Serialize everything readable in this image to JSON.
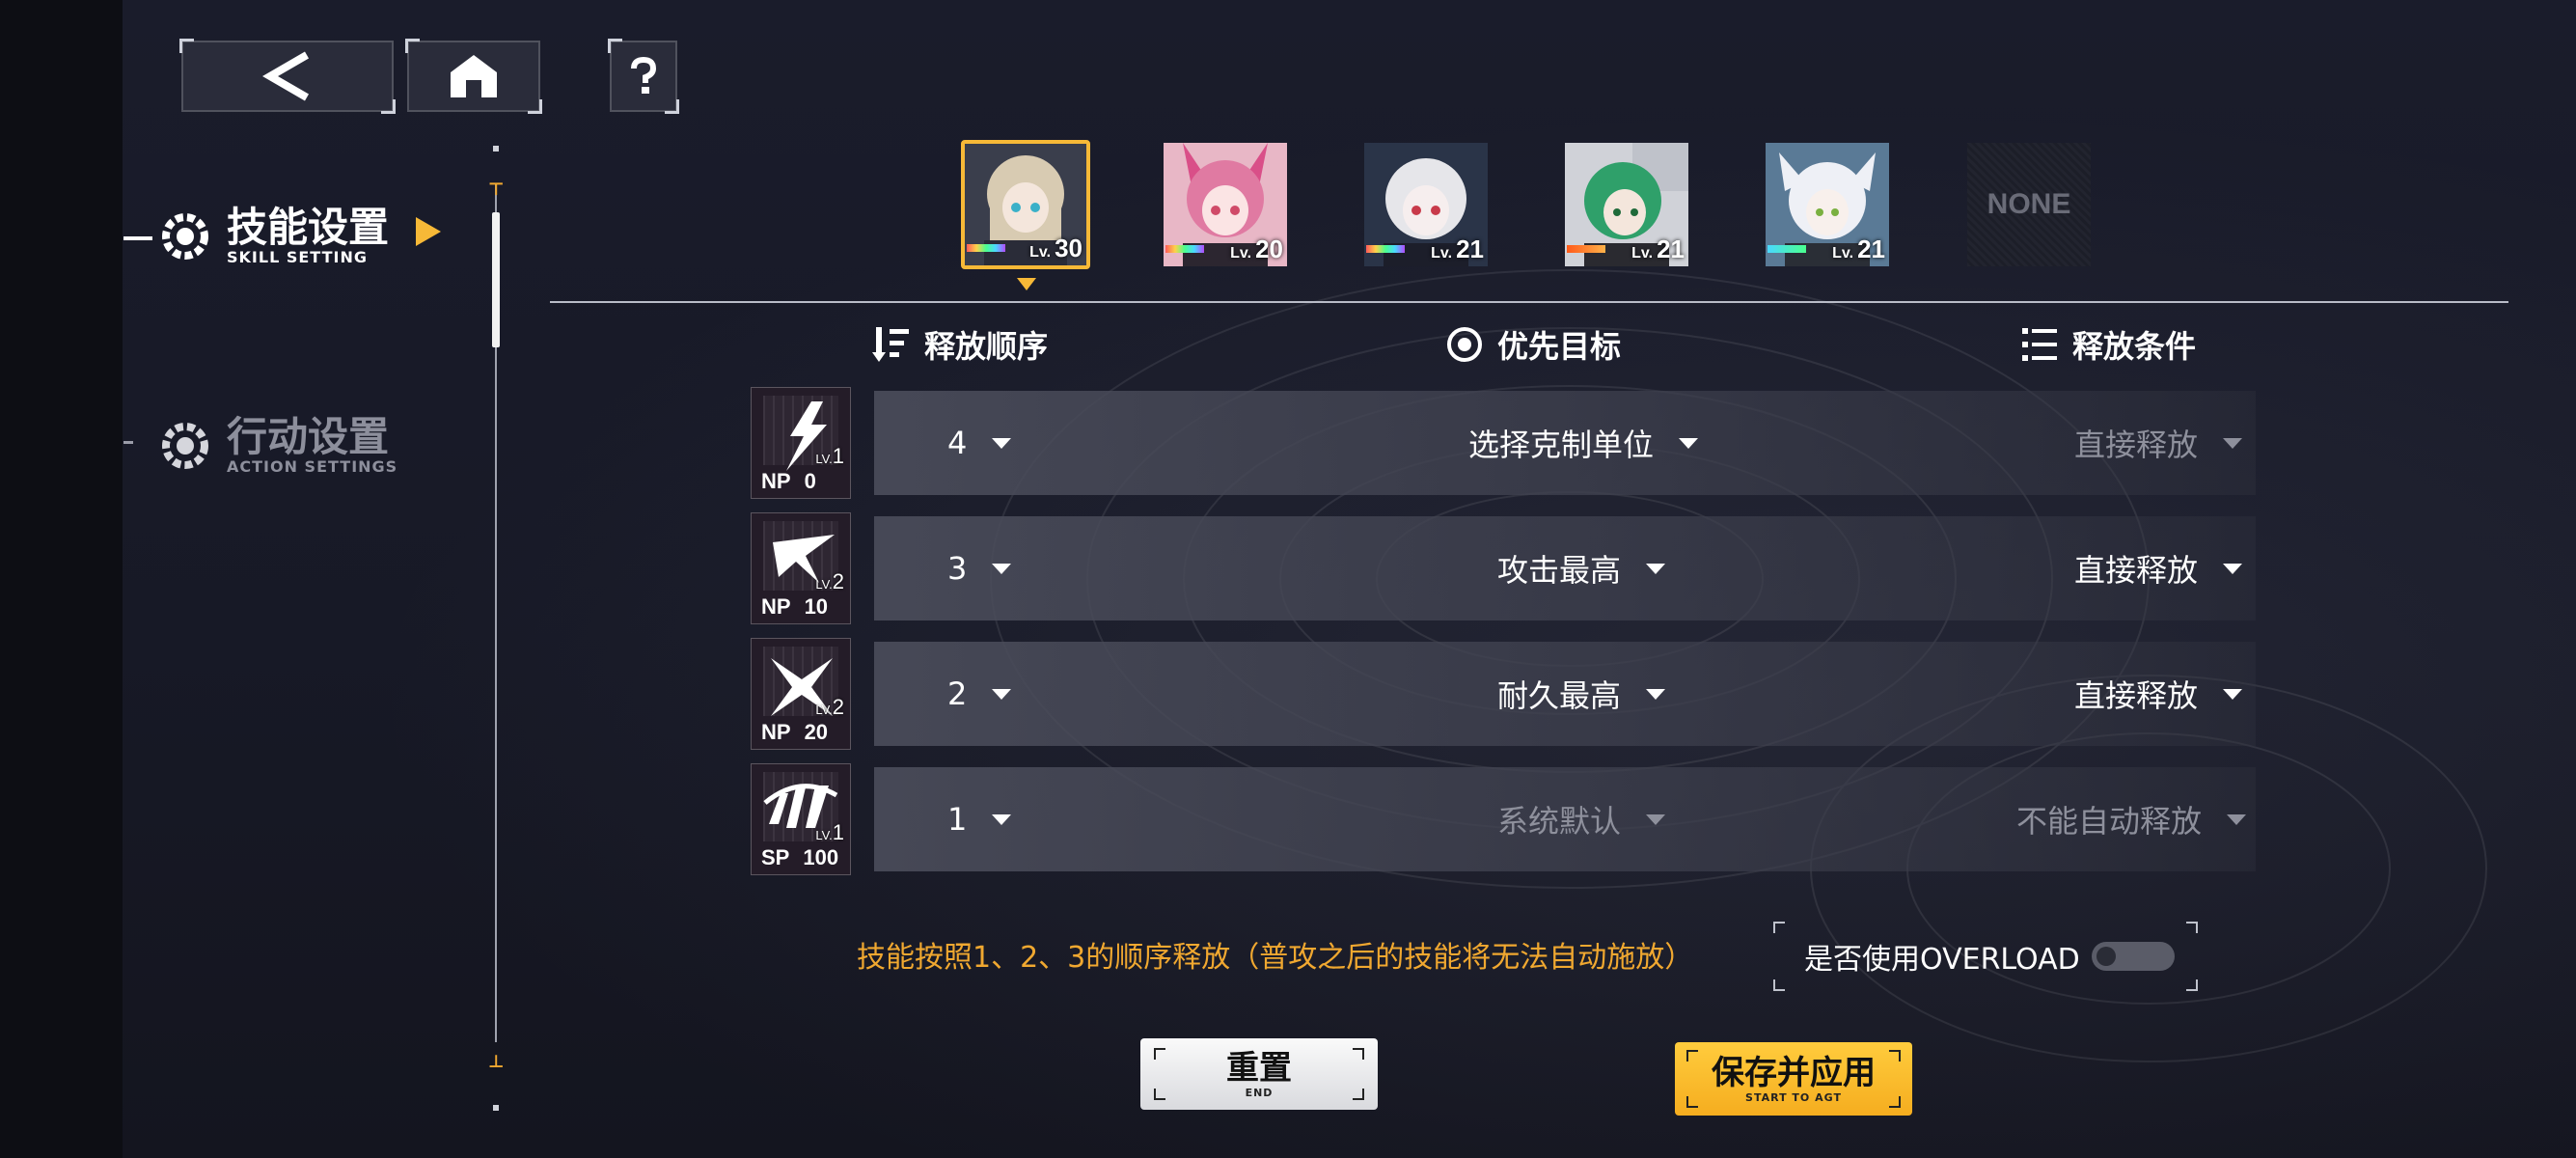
{
  "nav": {
    "back_icon": "back-arrow-icon",
    "home_icon": "home-icon",
    "help_icon": "question-icon"
  },
  "menu": [
    {
      "title": "技能设置",
      "subtitle": "SKILL SETTING",
      "active": true
    },
    {
      "title": "行动设置",
      "subtitle": "ACTION SETTINGS",
      "active": false
    }
  ],
  "characters": [
    {
      "level_prefix": "Lv.",
      "level": "30",
      "selected": true,
      "hair": "#d8cbb2",
      "accent": "#8ea6c8"
    },
    {
      "level_prefix": "Lv.",
      "level": "20",
      "selected": false,
      "hair": "#e07aa2",
      "accent": "#f0b4c8"
    },
    {
      "level_prefix": "Lv.",
      "level": "21",
      "selected": false,
      "hair": "#e6e6ea",
      "accent": "#2a3448"
    },
    {
      "level_prefix": "Lv.",
      "level": "21",
      "selected": false,
      "hair": "#2fa06a",
      "accent": "#d0d2d8"
    },
    {
      "level_prefix": "Lv.",
      "level": "21",
      "selected": false,
      "hair": "#eef0f6",
      "accent": "#8ed0e0"
    }
  ],
  "empty_slot_label": "NONE",
  "columns": {
    "order": "释放顺序",
    "target": "优先目标",
    "condition": "释放条件"
  },
  "skills": [
    {
      "lv_prefix": "LV.",
      "lv": "1",
      "cost_type": "NP",
      "cost": "0",
      "order": "4",
      "target": "选择克制单位",
      "target_enabled": true,
      "condition": "直接释放",
      "condition_enabled": false
    },
    {
      "lv_prefix": "LV.",
      "lv": "2",
      "cost_type": "NP",
      "cost": "10",
      "order": "3",
      "target": "攻击最高",
      "target_enabled": true,
      "condition": "直接释放",
      "condition_enabled": true
    },
    {
      "lv_prefix": "LV.",
      "lv": "2",
      "cost_type": "NP",
      "cost": "20",
      "order": "2",
      "target": "耐久最高",
      "target_enabled": true,
      "condition": "直接释放",
      "condition_enabled": true
    },
    {
      "lv_prefix": "LV.",
      "lv": "1",
      "cost_type": "SP",
      "cost": "100",
      "order": "1",
      "target": "系统默认",
      "target_enabled": false,
      "condition": "不能自动释放",
      "condition_enabled": false
    }
  ],
  "hint": "技能按照1、2、3的顺序释放（普攻之后的技能将无法自动施放）",
  "overload": {
    "label": "是否使用OVERLOAD",
    "enabled": false
  },
  "buttons": {
    "reset": "重置",
    "reset_sub": "END",
    "save": "保存并应用",
    "save_sub": "START TO AGT"
  },
  "colors": {
    "accent": "#f7b937",
    "hint": "#f0a830",
    "background": "#161826"
  }
}
